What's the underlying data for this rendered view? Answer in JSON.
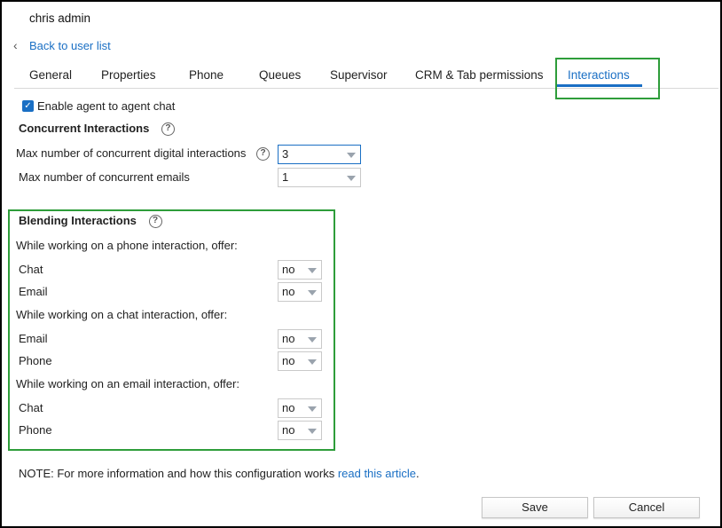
{
  "header": {
    "user_name": "chris admin",
    "back_link": "Back to user list"
  },
  "tabs": [
    {
      "label": "General"
    },
    {
      "label": "Properties"
    },
    {
      "label": "Phone"
    },
    {
      "label": "Queues"
    },
    {
      "label": "Supervisor"
    },
    {
      "label": "CRM & Tab permissions"
    },
    {
      "label": "Interactions",
      "active": true
    }
  ],
  "agent_chat": {
    "label": "Enable agent to agent chat",
    "checked": true
  },
  "concurrent": {
    "heading": "Concurrent Interactions",
    "digital_label": "Max number of concurrent digital interactions",
    "digital_value": "3",
    "emails_label": "Max number of concurrent emails",
    "emails_value": "1"
  },
  "blending": {
    "heading": "Blending Interactions",
    "phone_group": "While working on a phone interaction, offer:",
    "phone_chat_label": "Chat",
    "phone_chat_value": "no",
    "phone_email_label": "Email",
    "phone_email_value": "no",
    "chat_group": "While working on a chat interaction, offer:",
    "chat_email_label": "Email",
    "chat_email_value": "no",
    "chat_phone_label": "Phone",
    "chat_phone_value": "no",
    "email_group": "While working on an email interaction, offer:",
    "email_chat_label": "Chat",
    "email_chat_value": "no",
    "email_phone_label": "Phone",
    "email_phone_value": "no"
  },
  "note": {
    "prefix": "NOTE: For more information and how this configuration works ",
    "link": "read this article",
    "suffix": "."
  },
  "buttons": {
    "save": "Save",
    "cancel": "Cancel"
  },
  "icons": {
    "help": "help-circle-icon",
    "back": "chevron-left-icon",
    "checkbox": "checkmark-icon",
    "dropdown": "caret-down-icon"
  },
  "colors": {
    "accent": "#1a6fc4",
    "highlight": "#2e9d3a"
  }
}
